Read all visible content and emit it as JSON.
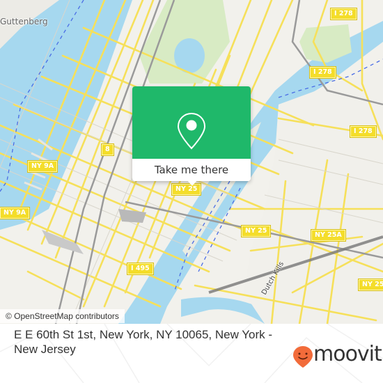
{
  "map": {
    "place_labels": [
      {
        "text": "Guttenberg"
      }
    ],
    "road_shields": [
      {
        "text": "I 278"
      },
      {
        "text": "I 278"
      },
      {
        "text": "I 278"
      },
      {
        "text": "8"
      },
      {
        "text": "NY 9A"
      },
      {
        "text": "NY 9A"
      },
      {
        "text": "NY 25"
      },
      {
        "text": "NY 25"
      },
      {
        "text": "NY 25A"
      },
      {
        "text": "NY 25"
      },
      {
        "text": "I 495"
      }
    ],
    "water_label": "Dutch Kills",
    "attribution": "© OpenStreetMap contributors",
    "colors": {
      "land": "#f2f1ec",
      "water": "#a6d8ef",
      "park": "#d8ebc4",
      "road_major": "#f6e05a",
      "road_minor": "#ffffff",
      "rail": "#999999",
      "ferry": "#4a6de5"
    }
  },
  "popup": {
    "pin_icon": "map-pin-outline",
    "button_label": "Take me there",
    "accent": "#1fb86a"
  },
  "footer": {
    "address": "E E 60th St 1st, New York, NY 10065, New York - New Jersey",
    "brand": "moovit",
    "brand_color": "#f26b3a"
  }
}
